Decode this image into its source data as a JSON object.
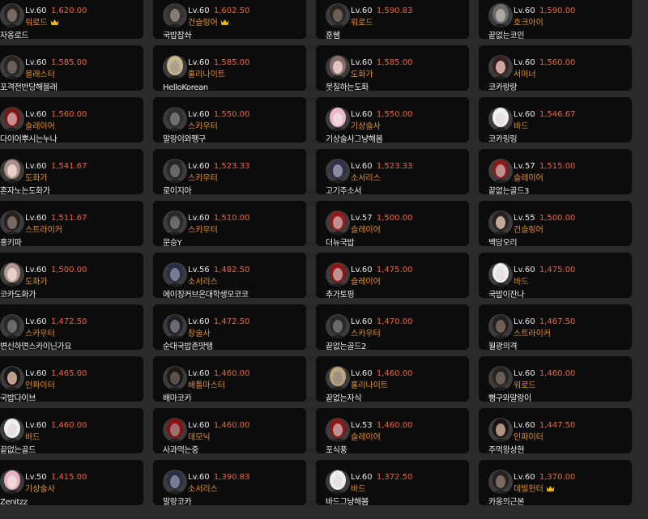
{
  "characters": [
    {
      "level": "Lv.60",
      "score": "1,620.00",
      "class": "워로드",
      "name": "자옹로드",
      "crown": true,
      "skin": "#7a6a60",
      "hair": "#2a2420"
    },
    {
      "level": "Lv.60",
      "score": "1,602.50",
      "class": "건슬링어",
      "name": "국밥잡솨",
      "crown": true,
      "skin": "#8a7a70",
      "hair": "#3a3030"
    },
    {
      "level": "Lv.60",
      "score": "1,590.83",
      "class": "워로드",
      "name": "훈쌤",
      "crown": false,
      "skin": "#6a6058",
      "hair": "#2a2622"
    },
    {
      "level": "Lv.60",
      "score": "1,590.00",
      "class": "호크아이",
      "name": "끝없는코인",
      "crown": false,
      "skin": "#b0a8a0",
      "hair": "#6a6a6a"
    },
    {
      "level": "Lv.60",
      "score": "1,585.00",
      "class": "블래스터",
      "name": "포격전반당해블래",
      "crown": false,
      "skin": "#6a6058",
      "hair": "#2a2420"
    },
    {
      "level": "Lv.60",
      "score": "1,585.00",
      "class": "홀리나이트",
      "name": "HelloKorean",
      "crown": false,
      "skin": "#b0a090",
      "hair": "#c8b890"
    },
    {
      "level": "Lv.60",
      "score": "1,585.00",
      "class": "도화가",
      "name": "붓칠하는도화",
      "crown": false,
      "skin": "#e0c8c0",
      "hair": "#8a7068"
    },
    {
      "level": "Lv.60",
      "score": "1,560.00",
      "class": "서머너",
      "name": "코카랑랑",
      "crown": false,
      "skin": "#c8a8a0",
      "hair": "#3a2020"
    },
    {
      "level": "Lv.60",
      "score": "1,560.00",
      "class": "슬레이어",
      "name": "다이어뿌시는누나",
      "crown": false,
      "skin": "#c89090",
      "hair": "#7a1818"
    },
    {
      "level": "Lv.60",
      "score": "1,550.00",
      "class": "스카우터",
      "name": "말랑이와펭구",
      "crown": false,
      "skin": "#707070",
      "hair": "#303030"
    },
    {
      "level": "Lv.60",
      "score": "1,550.00",
      "class": "기상술사",
      "name": "기상술사그냥해봄",
      "crown": false,
      "skin": "#f0d8d8",
      "hair": "#e8b8c8"
    },
    {
      "level": "Lv.60",
      "score": "1,546.67",
      "class": "바드",
      "name": "코카링링",
      "crown": false,
      "skin": "#e8e0e0",
      "hair": "#f0f0f0"
    },
    {
      "level": "Lv.60",
      "score": "1,541.67",
      "class": "도화가",
      "name": "혼자노는도화가",
      "crown": false,
      "skin": "#e8d0c8",
      "hair": "#a89088"
    },
    {
      "level": "Lv.60",
      "score": "1,523.33",
      "class": "스카우터",
      "name": "로이지아",
      "crown": false,
      "skin": "#686868",
      "hair": "#282828"
    },
    {
      "level": "Lv.60",
      "score": "1,523.33",
      "class": "소서리스",
      "name": "고기주소서",
      "crown": false,
      "skin": "#8a8aa0",
      "hair": "#303048"
    },
    {
      "level": "Lv.57",
      "score": "1,515.00",
      "class": "슬레이어",
      "name": "끝없는골드3",
      "crown": false,
      "skin": "#c09090",
      "hair": "#8a1c1c"
    },
    {
      "level": "Lv.60",
      "score": "1,511.67",
      "class": "스트라이커",
      "name": "홍키파",
      "crown": false,
      "skin": "#786860",
      "hair": "#282020"
    },
    {
      "level": "Lv.60",
      "score": "1,510.00",
      "class": "스카우터",
      "name": "문승Y",
      "crown": false,
      "skin": "#6a6a6a",
      "hair": "#2a2a2a"
    },
    {
      "level": "Lv.57",
      "score": "1,500.00",
      "class": "슬레이어",
      "name": "더뉴국밥",
      "crown": false,
      "skin": "#c09090",
      "hair": "#901c1c"
    },
    {
      "level": "Lv.55",
      "score": "1,500.00",
      "class": "건슬링어",
      "name": "백담오리",
      "crown": false,
      "skin": "#c0a898",
      "hair": "#2a2020"
    },
    {
      "level": "Lv.60",
      "score": "1,500.00",
      "class": "도화가",
      "name": "코카도화가",
      "crown": false,
      "skin": "#e8d0c8",
      "hair": "#b09890"
    },
    {
      "level": "Lv.56",
      "score": "1,482.50",
      "class": "소서리스",
      "name": "에이징커브온대학생모코코",
      "crown": false,
      "skin": "#7a7a90",
      "hair": "#283048"
    },
    {
      "level": "Lv.60",
      "score": "1,475.00",
      "class": "슬레이어",
      "name": "추가토핑",
      "crown": false,
      "skin": "#c09090",
      "hair": "#8a1818"
    },
    {
      "level": "Lv.60",
      "score": "1,475.00",
      "class": "바드",
      "name": "국밥이잔나",
      "crown": false,
      "skin": "#e8e0e0",
      "hair": "#eeeeee"
    },
    {
      "level": "Lv.60",
      "score": "1,472.50",
      "class": "스카우터",
      "name": "변신하면스카이닌가요",
      "crown": false,
      "skin": "#6a6a6a",
      "hair": "#2a2a2a"
    },
    {
      "level": "Lv.60",
      "score": "1,472.50",
      "class": "창술사",
      "name": "순대국밥존맛탱",
      "crown": false,
      "skin": "#6a6a78",
      "hair": "#202028"
    },
    {
      "level": "Lv.60",
      "score": "1,470.00",
      "class": "스카우터",
      "name": "끝없는골드2",
      "crown": false,
      "skin": "#6a6a6a",
      "hair": "#2a2a2a"
    },
    {
      "level": "Lv.60",
      "score": "1,467.50",
      "class": "스트라이커",
      "name": "월광의격",
      "crown": false,
      "skin": "#706058",
      "hair": "#282020"
    },
    {
      "level": "Lv.60",
      "score": "1,465.00",
      "class": "인파이터",
      "name": "국밥다이브",
      "crown": false,
      "skin": "#c0a090",
      "hair": "#1c1818"
    },
    {
      "level": "Lv.60",
      "score": "1,460.00",
      "class": "배틀마스터",
      "name": "배마코카",
      "crown": false,
      "skin": "#5a5050",
      "hair": "#201818"
    },
    {
      "level": "Lv.60",
      "score": "1,460.00",
      "class": "홀리나이트",
      "name": "끝없는자식",
      "crown": false,
      "skin": "#a09080",
      "hair": "#b8a880"
    },
    {
      "level": "Lv.60",
      "score": "1,460.00",
      "class": "워로드",
      "name": "뻥구와말랑이",
      "crown": false,
      "skin": "#6a6058",
      "hair": "#2a2420"
    },
    {
      "level": "Lv.60",
      "score": "1,460.00",
      "class": "바드",
      "name": "끝없는골드",
      "crown": false,
      "skin": "#e8e0e0",
      "hair": "#f0f0f0"
    },
    {
      "level": "Lv.60",
      "score": "1,460.00",
      "class": "데모닉",
      "name": "사과먹는중",
      "crown": false,
      "skin": "#a07070",
      "hair": "#8a1010"
    },
    {
      "level": "Lv.53",
      "score": "1,460.00",
      "class": "슬레이어",
      "name": "포식풍",
      "crown": false,
      "skin": "#c09090",
      "hair": "#8a1818"
    },
    {
      "level": "Lv.60",
      "score": "1,447.50",
      "class": "인파이터",
      "name": "주먹왕상현",
      "crown": false,
      "skin": "#b09080",
      "hair": "#181414"
    },
    {
      "level": "Lv.50",
      "score": "1,415.00",
      "class": "기상술사",
      "name": "Zenitzz",
      "crown": false,
      "skin": "#f0d8d8",
      "hair": "#e8b0c0"
    },
    {
      "level": "Lv.60",
      "score": "1,390.83",
      "class": "소서리스",
      "name": "말랑코카",
      "crown": false,
      "skin": "#7a7a90",
      "hair": "#283048"
    },
    {
      "level": "Lv.60",
      "score": "1,372.50",
      "class": "바드",
      "name": "바드그냥해봄",
      "crown": false,
      "skin": "#e8e0e0",
      "hair": "#eeeeee"
    },
    {
      "level": "Lv.60",
      "score": "1,370.00",
      "class": "데빌헌터",
      "name": "카옹의근본",
      "crown": true,
      "skin": "#7a6a60",
      "hair": "#2a2020"
    }
  ],
  "colors": {
    "score": "#f0623c",
    "class": "#e8902a",
    "crown": "#f4b400",
    "card_bg": "#0c0c0c",
    "page_bg": "#2a2a2a"
  }
}
